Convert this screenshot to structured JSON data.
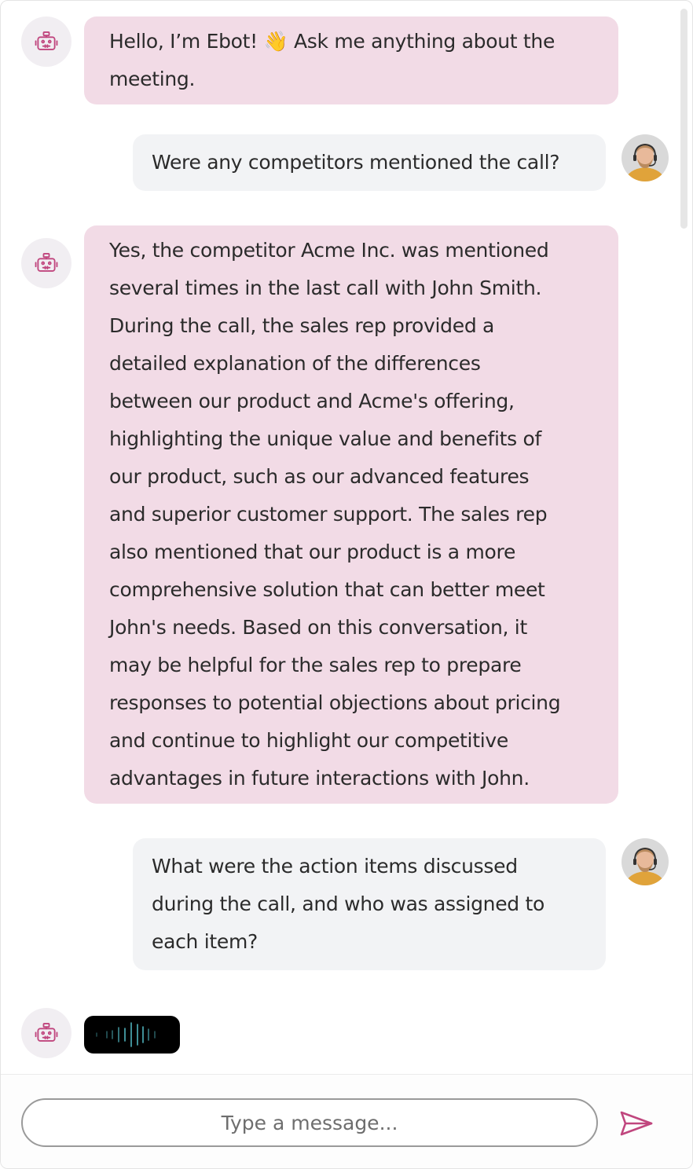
{
  "chat": {
    "messages": [
      {
        "role": "bot",
        "text": "Hello, I’m Ebot! 👋 Ask me anything about the\nmeeting."
      },
      {
        "role": "user",
        "text": "Were any competitors mentioned the call?"
      },
      {
        "role": "bot",
        "text": "Yes, the competitor Acme Inc. was mentioned\nseveral times in the last call with John Smith.\nDuring the call, the sales rep provided a\ndetailed explanation of the differences\nbetween our product and Acme's offering,\nhighlighting the unique value and benefits of\nour product, such as our advanced features\nand superior customer support. The sales rep\nalso mentioned that our product is a more\ncomprehensive solution that can better meet\nJohn's needs. Based on this conversation, it\nmay be helpful for the sales rep to prepare\nresponses to potential objections about pricing\nand continue to highlight our competitive\nadvantages in future interactions with John."
      },
      {
        "role": "user",
        "text": "What were the action items discussed\nduring the call, and who was assigned to\neach item?"
      }
    ]
  },
  "composer": {
    "placeholder": "Type a message..."
  },
  "icons": {
    "bot": "robot-icon",
    "user": "user-avatar",
    "send": "send-icon",
    "typing": "typing-waveform-icon"
  },
  "colors": {
    "bot_bubble": "#f2dbe6",
    "user_bubble": "#f2f3f5",
    "accent": "#c0467e",
    "typing_bars": "#4fb3bd"
  }
}
